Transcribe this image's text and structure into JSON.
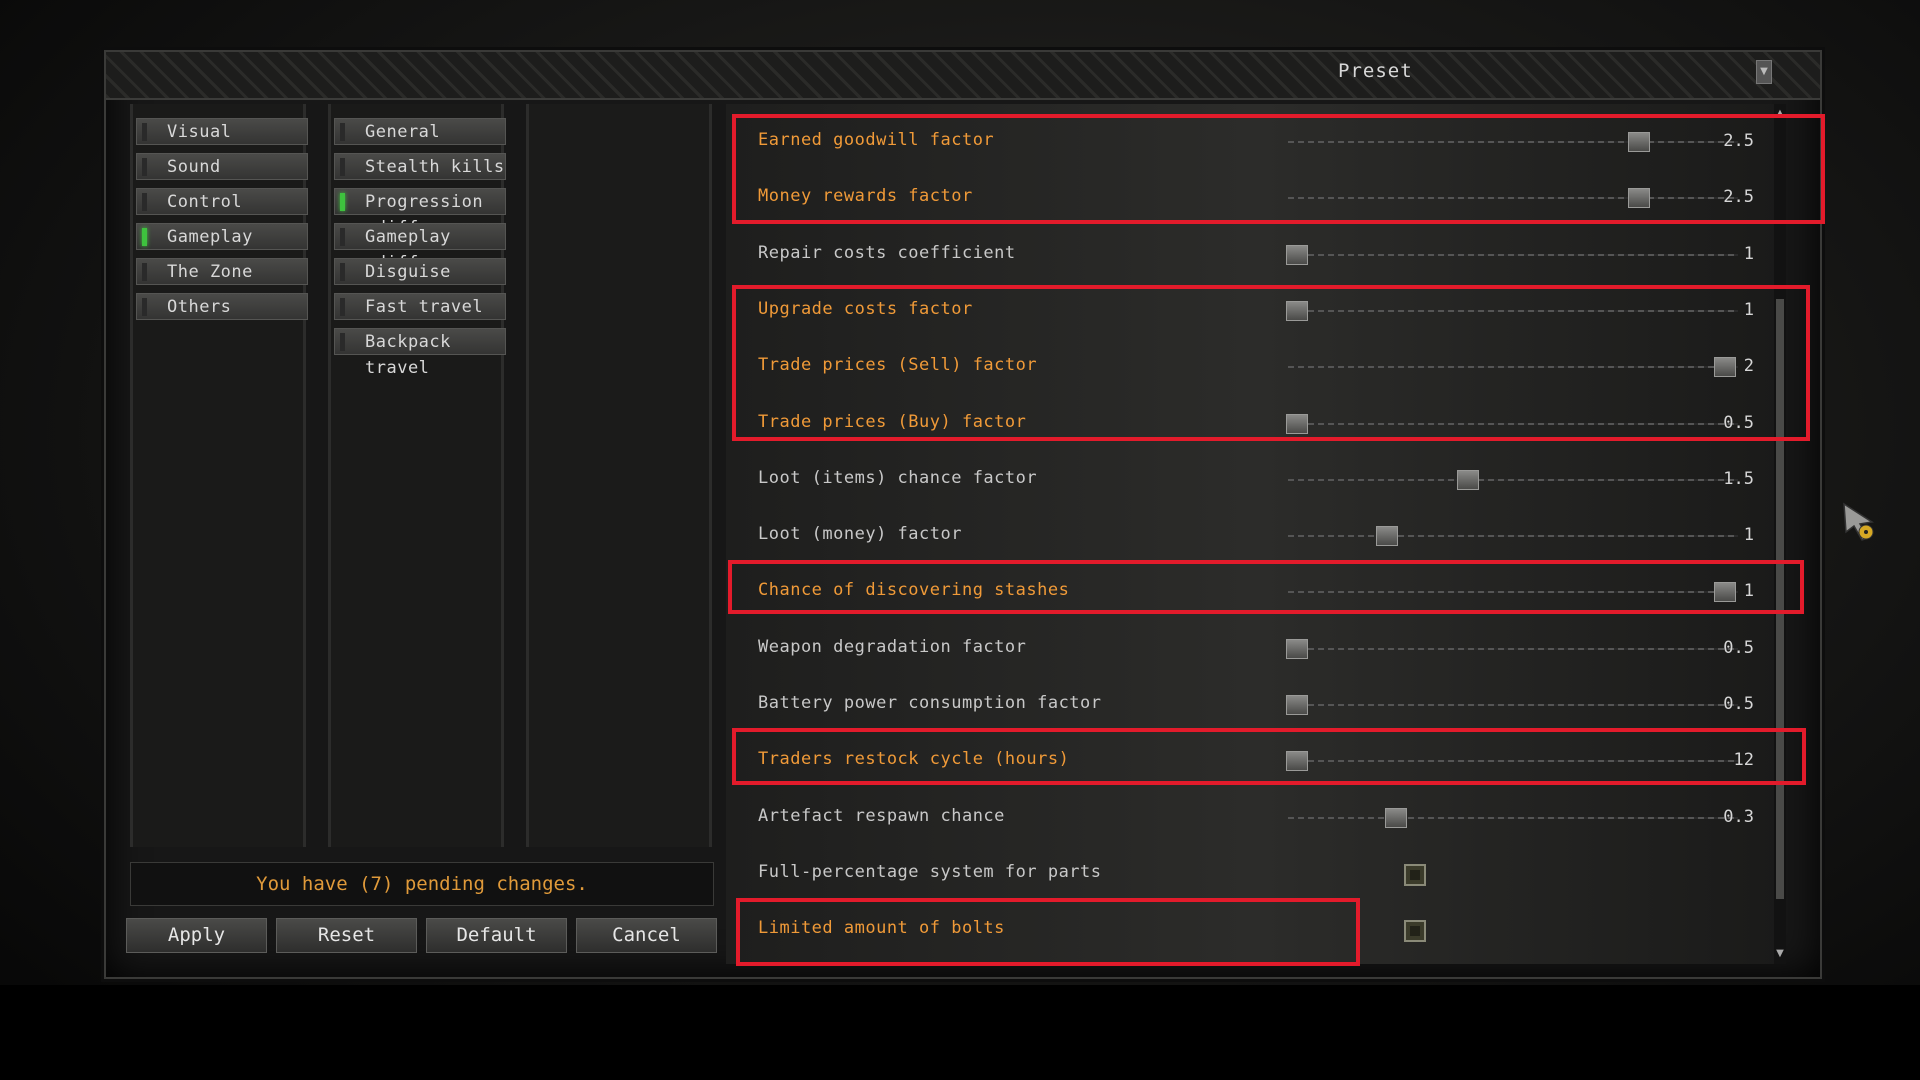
{
  "preset": {
    "label": "Preset"
  },
  "categories": [
    {
      "label": "Visual",
      "active": false
    },
    {
      "label": "Sound",
      "active": false
    },
    {
      "label": "Control",
      "active": false
    },
    {
      "label": "Gameplay",
      "active": true
    },
    {
      "label": "The Zone",
      "active": false
    },
    {
      "label": "Others",
      "active": false
    }
  ],
  "subcategories": [
    {
      "label": "General",
      "active": false
    },
    {
      "label": "Stealth kills",
      "active": false
    },
    {
      "label": "Progression .diff",
      "active": true
    },
    {
      "label": "Gameplay .diff",
      "active": false
    },
    {
      "label": "Disguise",
      "active": false
    },
    {
      "label": "Fast travel",
      "active": false
    },
    {
      "label": "Backpack travel",
      "active": false
    }
  ],
  "status": {
    "pending": "You have (7) pending changes."
  },
  "buttons": {
    "apply": "Apply",
    "reset": "Reset",
    "default": "Default",
    "cancel": "Cancel"
  },
  "settings": [
    {
      "label": "Earned goodwill factor",
      "value": "2.5",
      "fraction": 0.78,
      "highlight": true
    },
    {
      "label": "Money rewards factor",
      "value": "2.5",
      "fraction": 0.78,
      "highlight": true
    },
    {
      "label": "Repair costs coefficient",
      "value": "1",
      "fraction": 0.02,
      "highlight": false
    },
    {
      "label": "Upgrade costs factor",
      "value": "1",
      "fraction": 0.02,
      "highlight": true
    },
    {
      "label": "Trade prices (Sell) factor",
      "value": "2",
      "fraction": 0.97,
      "highlight": true
    },
    {
      "label": "Trade prices (Buy) factor",
      "value": "0.5",
      "fraction": 0.02,
      "highlight": true
    },
    {
      "label": "Loot (items) chance factor",
      "value": "1.5",
      "fraction": 0.4,
      "highlight": false
    },
    {
      "label": "Loot (money) factor",
      "value": "1",
      "fraction": 0.22,
      "highlight": false
    },
    {
      "label": "Chance of discovering stashes",
      "value": "1",
      "fraction": 0.97,
      "highlight": true
    },
    {
      "label": "Weapon degradation factor",
      "value": "0.5",
      "fraction": 0.02,
      "highlight": false
    },
    {
      "label": "Battery power consumption factor",
      "value": "0.5",
      "fraction": 0.02,
      "highlight": false
    },
    {
      "label": "Traders restock cycle (hours)",
      "value": "12",
      "fraction": 0.02,
      "highlight": true
    },
    {
      "label": "Artefact respawn chance",
      "value": "0.3",
      "fraction": 0.24,
      "highlight": false
    },
    {
      "label": "Full-percentage system for parts",
      "type": "checkbox",
      "checked": false,
      "highlight": false
    },
    {
      "label": "Limited amount of bolts",
      "type": "checkbox",
      "checked": false,
      "highlight": true
    }
  ],
  "colors": {
    "highlight_text": "#f09a38",
    "annotation": "#e31b2b",
    "active_led": "#3ec23e"
  }
}
